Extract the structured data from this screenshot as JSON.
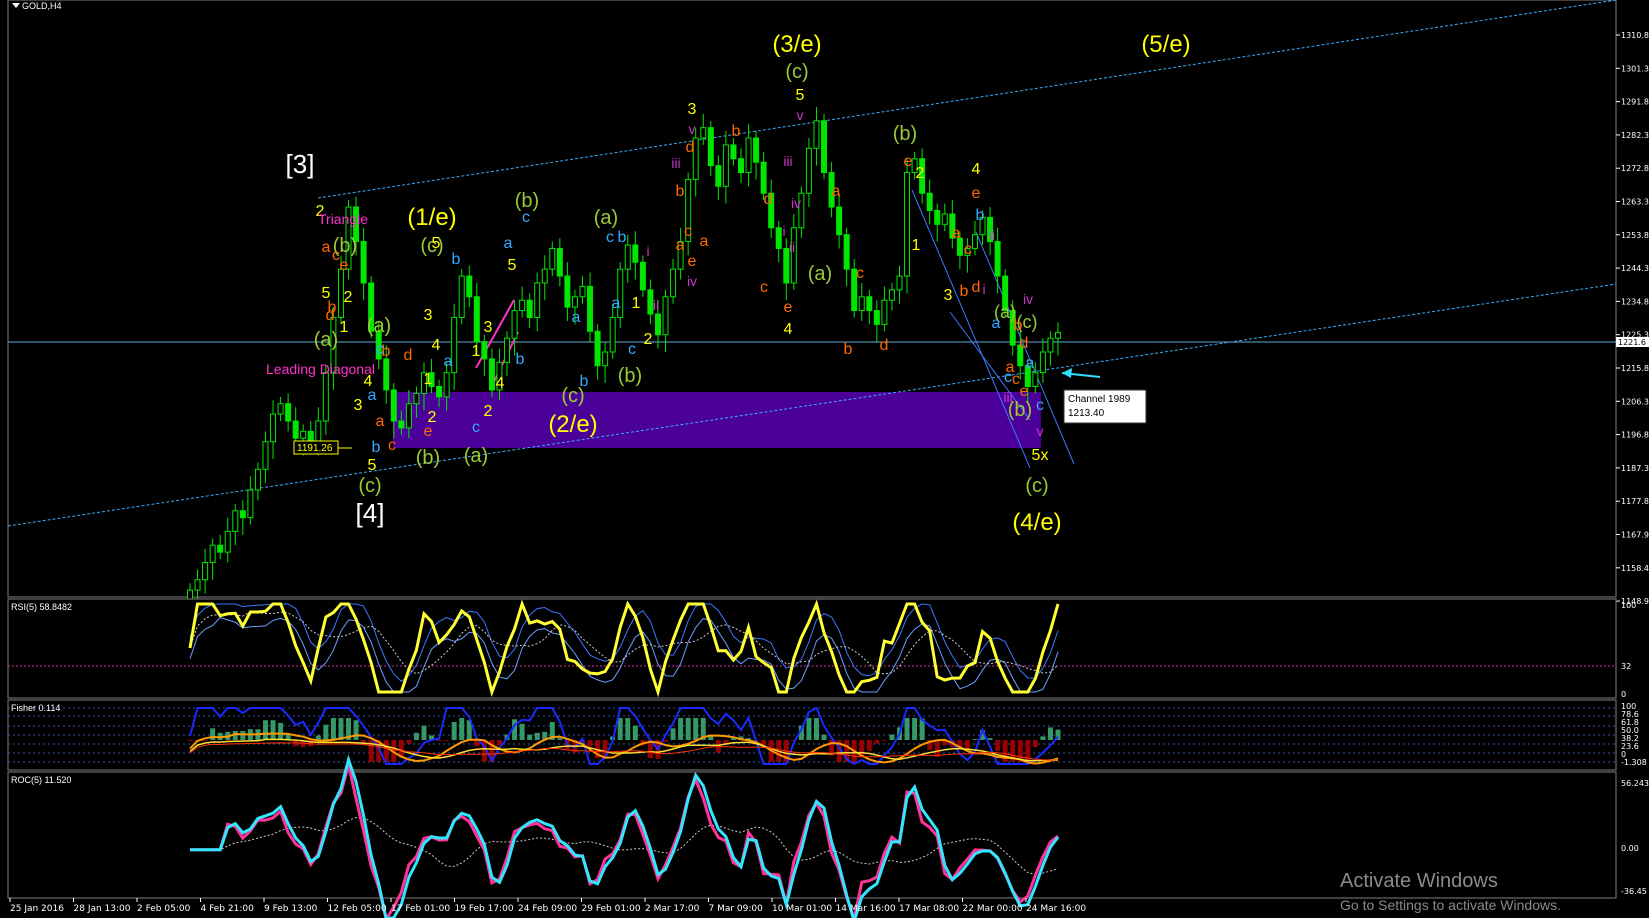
{
  "symbol": "GOLD,H4",
  "colors": {
    "background": "#000000",
    "candle": "#00e600",
    "channel": "#3fa9f5",
    "zone": "#4b0099",
    "rsi_main": "#ffff33",
    "rsi_band": "#3a78ff",
    "roc_cyan": "#33e6ff",
    "roc_pink": "#ff3399"
  },
  "price_axis": {
    "ticks": [
      "1310.8",
      "1301.3",
      "1291.8",
      "1282.3",
      "1272.8",
      "1263.3",
      "1253.8",
      "1244.3",
      "1234.8",
      "1225.3",
      "1215.8",
      "1206.3",
      "1196.8",
      "1187.3",
      "1177.8",
      "1167.9",
      "1158.4",
      "1148.9"
    ],
    "current_price": "1221.6"
  },
  "panels": {
    "rsi": {
      "label": "RSI(5) 58.8482",
      "ticks": [
        "100",
        "32",
        "0"
      ]
    },
    "stoch": {
      "label": "Fisher 0.114",
      "ticks": [
        "100",
        "78.6",
        "61.8",
        "50.0",
        "38.2",
        "23.6",
        "0",
        "-1.308"
      ]
    },
    "roc": {
      "label": "ROC(5) 11.520",
      "ticks": [
        "56.243",
        "0.00",
        "-36.45"
      ]
    }
  },
  "time_axis": [
    "25 Jan 2016",
    "28 Jan 13:00",
    "2 Feb 05:00",
    "4 Feb 21:00",
    "9 Feb 13:00",
    "12 Feb 05:00",
    "17 Feb 01:00",
    "19 Feb 17:00",
    "24 Feb 09:00",
    "29 Feb 01:00",
    "2 Mar 17:00",
    "7 Mar 09:00",
    "10 Mar 01:00",
    "14 Mar 16:00",
    "17 Mar 08:00",
    "22 Mar 00:00",
    "24 Mar 16:00"
  ],
  "annotations": {
    "channel_box_title": "Channel 1989",
    "channel_box_value": "1213.40",
    "level_label": "1191.26",
    "triangle": "Triangle",
    "leading_diagonal": "Leading Diagonal"
  },
  "waves": [
    {
      "t": "[3]",
      "c": "#ffffff",
      "s": 26,
      "x": 300,
      "y": 173
    },
    {
      "t": "[4]",
      "c": "#ffffff",
      "s": 26,
      "x": 370,
      "y": 522
    },
    {
      "t": "(1/e)",
      "c": "#ffff00",
      "s": 24,
      "x": 432,
      "y": 225
    },
    {
      "t": "(2/e)",
      "c": "#ffff00",
      "s": 24,
      "x": 573,
      "y": 432
    },
    {
      "t": "(3/e)",
      "c": "#ffff00",
      "s": 24,
      "x": 797,
      "y": 52
    },
    {
      "t": "(4/e)",
      "c": "#ffff00",
      "s": 24,
      "x": 1037,
      "y": 530
    },
    {
      "t": "(5/e)",
      "c": "#ffff00",
      "s": 24,
      "x": 1166,
      "y": 52
    },
    {
      "t": "(c)",
      "c": "#99cc33",
      "s": 20,
      "x": 797,
      "y": 78
    },
    {
      "t": "(c)",
      "c": "#99cc33",
      "s": 20,
      "x": 432,
      "y": 252
    },
    {
      "t": "(c)",
      "c": "#99cc33",
      "s": 20,
      "x": 370,
      "y": 492
    },
    {
      "t": "(c)",
      "c": "#99cc33",
      "s": 20,
      "x": 573,
      "y": 402
    },
    {
      "t": "(c)",
      "c": "#99cc33",
      "s": 20,
      "x": 1037,
      "y": 492
    },
    {
      "t": "(b)",
      "c": "#99cc33",
      "s": 20,
      "x": 527,
      "y": 207
    },
    {
      "t": "(b)",
      "c": "#99cc33",
      "s": 20,
      "x": 905,
      "y": 140
    },
    {
      "t": "(b)",
      "c": "#99cc33",
      "s": 20,
      "x": 345,
      "y": 252
    },
    {
      "t": "(b)",
      "c": "#99cc33",
      "s": 20,
      "x": 428,
      "y": 464
    },
    {
      "t": "(b)",
      "c": "#99cc33",
      "s": 20,
      "x": 630,
      "y": 382
    },
    {
      "t": "(b)",
      "c": "#99cc33",
      "s": 20,
      "x": 1020,
      "y": 416
    },
    {
      "t": "(a)",
      "c": "#99cc33",
      "s": 20,
      "x": 606,
      "y": 224
    },
    {
      "t": "(a)",
      "c": "#99cc33",
      "s": 20,
      "x": 379,
      "y": 332
    },
    {
      "t": "(a)",
      "c": "#99cc33",
      "s": 20,
      "x": 326,
      "y": 346
    },
    {
      "t": "(a)",
      "c": "#99cc33",
      "s": 20,
      "x": 476,
      "y": 462
    },
    {
      "t": "(a)",
      "c": "#99cc33",
      "s": 20,
      "x": 820,
      "y": 280
    },
    {
      "t": "(a)",
      "c": "#99cc33",
      "s": 18,
      "x": 1005,
      "y": 318
    },
    {
      "t": "(c)",
      "c": "#99cc33",
      "s": 18,
      "x": 1027,
      "y": 328
    },
    {
      "t": "5",
      "c": "#ffff00",
      "s": 16,
      "x": 800,
      "y": 100
    },
    {
      "t": "3",
      "c": "#ffff00",
      "s": 16,
      "x": 692,
      "y": 114
    },
    {
      "t": "5",
      "c": "#ffff00",
      "s": 16,
      "x": 436,
      "y": 248
    },
    {
      "t": "5",
      "c": "#ffff00",
      "s": 16,
      "x": 512,
      "y": 270
    },
    {
      "t": "3",
      "c": "#ffff00",
      "s": 16,
      "x": 488,
      "y": 332
    },
    {
      "t": "3",
      "c": "#ffff00",
      "s": 16,
      "x": 428,
      "y": 320
    },
    {
      "t": "4",
      "c": "#ffff00",
      "s": 16,
      "x": 436,
      "y": 350
    },
    {
      "t": "1",
      "c": "#ffff00",
      "s": 16,
      "x": 428,
      "y": 384
    },
    {
      "t": "2",
      "c": "#ffff00",
      "s": 16,
      "x": 432,
      "y": 422
    },
    {
      "t": "1",
      "c": "#ffff00",
      "s": 16,
      "x": 476,
      "y": 356
    },
    {
      "t": "2",
      "c": "#ffff00",
      "s": 16,
      "x": 488,
      "y": 416
    },
    {
      "t": "4",
      "c": "#ffff00",
      "s": 16,
      "x": 500,
      "y": 388
    },
    {
      "t": "1",
      "c": "#ffff00",
      "s": 16,
      "x": 636,
      "y": 308
    },
    {
      "t": "2",
      "c": "#ffff00",
      "s": 16,
      "x": 648,
      "y": 344
    },
    {
      "t": "4",
      "c": "#ffff00",
      "s": 16,
      "x": 788,
      "y": 334
    },
    {
      "t": "2",
      "c": "#ffff00",
      "s": 16,
      "x": 920,
      "y": 178
    },
    {
      "t": "4",
      "c": "#ffff00",
      "s": 16,
      "x": 976,
      "y": 174
    },
    {
      "t": "1",
      "c": "#ffff00",
      "s": 16,
      "x": 916,
      "y": 250
    },
    {
      "t": "3",
      "c": "#ffff00",
      "s": 16,
      "x": 948,
      "y": 300
    },
    {
      "t": "5x",
      "c": "#ffff00",
      "s": 16,
      "x": 1040,
      "y": 460
    },
    {
      "t": "2",
      "c": "#ffff00",
      "s": 16,
      "x": 320,
      "y": 216
    },
    {
      "t": "2",
      "c": "#ffff00",
      "s": 16,
      "x": 348,
      "y": 302
    },
    {
      "t": "1",
      "c": "#ffff00",
      "s": 16,
      "x": 344,
      "y": 332
    },
    {
      "t": "5",
      "c": "#ffff00",
      "s": 16,
      "x": 326,
      "y": 298
    },
    {
      "t": "4",
      "c": "#ffff00",
      "s": 16,
      "x": 368,
      "y": 386
    },
    {
      "t": "3",
      "c": "#ffff00",
      "s": 16,
      "x": 358,
      "y": 410
    },
    {
      "t": "5",
      "c": "#ffff00",
      "s": 16,
      "x": 372,
      "y": 470
    },
    {
      "t": "e",
      "c": "#ff6600",
      "s": 16,
      "x": 428,
      "y": 436
    },
    {
      "t": "c",
      "c": "#ff6600",
      "s": 16,
      "x": 392,
      "y": 450
    },
    {
      "t": "a",
      "c": "#ff6600",
      "s": 16,
      "x": 380,
      "y": 426
    },
    {
      "t": "d",
      "c": "#ff6600",
      "s": 16,
      "x": 408,
      "y": 360
    },
    {
      "t": "b",
      "c": "#ff6600",
      "s": 16,
      "x": 386,
      "y": 356
    },
    {
      "t": "d",
      "c": "#ff6600",
      "s": 16,
      "x": 690,
      "y": 152
    },
    {
      "t": "b",
      "c": "#ff6600",
      "s": 16,
      "x": 736,
      "y": 136
    },
    {
      "t": "b",
      "c": "#ff6600",
      "s": 16,
      "x": 680,
      "y": 196
    },
    {
      "t": "c",
      "c": "#ff6600",
      "s": 16,
      "x": 688,
      "y": 236
    },
    {
      "t": "e",
      "c": "#ff6600",
      "s": 16,
      "x": 692,
      "y": 266
    },
    {
      "t": "a",
      "c": "#ff6600",
      "s": 16,
      "x": 704,
      "y": 246
    },
    {
      "t": "a",
      "c": "#ff6600",
      "s": 16,
      "x": 680,
      "y": 250
    },
    {
      "t": "d",
      "c": "#ff6600",
      "s": 16,
      "x": 768,
      "y": 204
    },
    {
      "t": "c",
      "c": "#ff6600",
      "s": 16,
      "x": 764,
      "y": 292
    },
    {
      "t": "e",
      "c": "#ff6600",
      "s": 16,
      "x": 788,
      "y": 312
    },
    {
      "t": "a",
      "c": "#ff6600",
      "s": 16,
      "x": 836,
      "y": 196
    },
    {
      "t": "c",
      "c": "#ff6600",
      "s": 16,
      "x": 860,
      "y": 278
    },
    {
      "t": "b",
      "c": "#ff6600",
      "s": 16,
      "x": 848,
      "y": 354
    },
    {
      "t": "d",
      "c": "#ff6600",
      "s": 16,
      "x": 884,
      "y": 350
    },
    {
      "t": "e",
      "c": "#ff6600",
      "s": 16,
      "x": 908,
      "y": 166
    },
    {
      "t": "e",
      "c": "#ff6600",
      "s": 16,
      "x": 976,
      "y": 198
    },
    {
      "t": "a",
      "c": "#ff6600",
      "s": 16,
      "x": 956,
      "y": 238
    },
    {
      "t": "c",
      "c": "#ff6600",
      "s": 16,
      "x": 968,
      "y": 254
    },
    {
      "t": "b",
      "c": "#ff6600",
      "s": 16,
      "x": 964,
      "y": 296
    },
    {
      "t": "d",
      "c": "#ff6600",
      "s": 16,
      "x": 976,
      "y": 292
    },
    {
      "t": "a",
      "c": "#ff6600",
      "s": 16,
      "x": 1010,
      "y": 372
    },
    {
      "t": "c",
      "c": "#ff6600",
      "s": 16,
      "x": 1016,
      "y": 384
    },
    {
      "t": "e",
      "c": "#ff6600",
      "s": 16,
      "x": 1024,
      "y": 396
    },
    {
      "t": "d",
      "c": "#ff6600",
      "s": 16,
      "x": 1024,
      "y": 348
    },
    {
      "t": "b",
      "c": "#ff6600",
      "s": 16,
      "x": 1018,
      "y": 330
    },
    {
      "t": "e",
      "c": "#ff6600",
      "s": 16,
      "x": 344,
      "y": 270
    },
    {
      "t": "c",
      "c": "#ff6600",
      "s": 16,
      "x": 336,
      "y": 260
    },
    {
      "t": "a",
      "c": "#ff6600",
      "s": 16,
      "x": 326,
      "y": 252
    },
    {
      "t": "d",
      "c": "#ff6600",
      "s": 16,
      "x": 330,
      "y": 320
    },
    {
      "t": "b",
      "c": "#ff6600",
      "s": 16,
      "x": 332,
      "y": 312
    },
    {
      "t": "c",
      "c": "#33aaff",
      "s": 16,
      "x": 526,
      "y": 222
    },
    {
      "t": "b",
      "c": "#33aaff",
      "s": 16,
      "x": 456,
      "y": 264
    },
    {
      "t": "a",
      "c": "#33aaff",
      "s": 16,
      "x": 508,
      "y": 248
    },
    {
      "t": "a",
      "c": "#33aaff",
      "s": 16,
      "x": 448,
      "y": 366
    },
    {
      "t": "a",
      "c": "#33aaff",
      "s": 16,
      "x": 372,
      "y": 400
    },
    {
      "t": "b",
      "c": "#33aaff",
      "s": 16,
      "x": 520,
      "y": 364
    },
    {
      "t": "c",
      "c": "#33aaff",
      "s": 16,
      "x": 476,
      "y": 432
    },
    {
      "t": "c",
      "c": "#33aaff",
      "s": 16,
      "x": 380,
      "y": 354
    },
    {
      "t": "b",
      "c": "#33aaff",
      "s": 16,
      "x": 376,
      "y": 452
    },
    {
      "t": "a",
      "c": "#33aaff",
      "s": 16,
      "x": 576,
      "y": 322
    },
    {
      "t": "b",
      "c": "#33aaff",
      "s": 16,
      "x": 584,
      "y": 386
    },
    {
      "t": "c",
      "c": "#33aaff",
      "s": 16,
      "x": 610,
      "y": 242
    },
    {
      "t": "b",
      "c": "#33aaff",
      "s": 16,
      "x": 622,
      "y": 242
    },
    {
      "t": "c",
      "c": "#33aaff",
      "s": 16,
      "x": 632,
      "y": 354
    },
    {
      "t": "a",
      "c": "#33aaff",
      "s": 16,
      "x": 616,
      "y": 308
    },
    {
      "t": "b",
      "c": "#33aaff",
      "s": 16,
      "x": 980,
      "y": 220
    },
    {
      "t": "a",
      "c": "#33aaff",
      "s": 16,
      "x": 996,
      "y": 328
    },
    {
      "t": "c",
      "c": "#33aaff",
      "s": 16,
      "x": 1040,
      "y": 410
    },
    {
      "t": "a",
      "c": "#33aaff",
      "s": 16,
      "x": 1030,
      "y": 368
    },
    {
      "t": "c",
      "c": "#33aaff",
      "s": 16,
      "x": 1008,
      "y": 382
    },
    {
      "t": "iii",
      "c": "#cc33cc",
      "s": 14,
      "x": 676,
      "y": 168
    },
    {
      "t": "v",
      "c": "#cc33cc",
      "s": 14,
      "x": 692,
      "y": 134
    },
    {
      "t": "iv",
      "c": "#cc33cc",
      "s": 14,
      "x": 692,
      "y": 286
    },
    {
      "t": "v",
      "c": "#cc33cc",
      "s": 14,
      "x": 800,
      "y": 120
    },
    {
      "t": "iii",
      "c": "#cc33cc",
      "s": 14,
      "x": 788,
      "y": 166
    },
    {
      "t": "iv",
      "c": "#cc33cc",
      "s": 14,
      "x": 796,
      "y": 208
    },
    {
      "t": "i",
      "c": "#cc33cc",
      "s": 14,
      "x": 784,
      "y": 236
    },
    {
      "t": "ii",
      "c": "#cc33cc",
      "s": 14,
      "x": 792,
      "y": 252
    },
    {
      "t": "i",
      "c": "#cc33cc",
      "s": 14,
      "x": 648,
      "y": 256
    },
    {
      "t": "ii",
      "c": "#cc33cc",
      "s": 14,
      "x": 656,
      "y": 310
    },
    {
      "t": "ii",
      "c": "#cc33cc",
      "s": 14,
      "x": 992,
      "y": 240
    },
    {
      "t": "i",
      "c": "#cc33cc",
      "s": 14,
      "x": 984,
      "y": 294
    },
    {
      "t": "iv",
      "c": "#cc33cc",
      "s": 14,
      "x": 1028,
      "y": 304
    },
    {
      "t": "iii",
      "c": "#cc33cc",
      "s": 14,
      "x": 1008,
      "y": 402
    },
    {
      "t": "v",
      "c": "#cc33cc",
      "s": 14,
      "x": 1040,
      "y": 436
    }
  ],
  "chart_data": {
    "type": "candlestick",
    "instrument": "GOLD",
    "timeframe": "H4",
    "period": "25 Jan 2016 – 24 Mar 2016",
    "last_price": 1221.6,
    "price_range": [
      1145,
      1318
    ],
    "channel_level": 1213.4,
    "marked_level": 1191.26,
    "support_zone": [
      1191,
      1207
    ],
    "close_series": [
      1147,
      1150,
      1155,
      1160,
      1158,
      1164,
      1170,
      1168,
      1176,
      1182,
      1190,
      1198,
      1201,
      1196,
      1191,
      1193,
      1189,
      1196,
      1210,
      1226,
      1240,
      1258,
      1248,
      1236,
      1222,
      1214,
      1205,
      1196,
      1194,
      1201,
      1204,
      1210,
      1206,
      1203,
      1210,
      1226,
      1238,
      1232,
      1219,
      1214,
      1205,
      1213,
      1220,
      1228,
      1231,
      1226,
      1236,
      1240,
      1246,
      1238,
      1229,
      1232,
      1235,
      1222,
      1212,
      1216,
      1226,
      1240,
      1247,
      1242,
      1234,
      1227,
      1221,
      1232,
      1240,
      1248,
      1266,
      1278,
      1281,
      1270,
      1264,
      1276,
      1272,
      1268,
      1278,
      1271,
      1262,
      1252,
      1246,
      1236,
      1252,
      1262,
      1275,
      1283,
      1268,
      1258,
      1250,
      1240,
      1228,
      1232,
      1228,
      1224,
      1231,
      1234,
      1238,
      1268,
      1272,
      1262,
      1257,
      1253,
      1256,
      1249,
      1244,
      1246,
      1250,
      1255,
      1248,
      1238,
      1228,
      1218,
      1212,
      1206,
      1210,
      1216,
      1220,
      1221.6
    ],
    "rsi": {
      "name": "RSI(5)",
      "last": 58.8482,
      "levels": [
        100,
        32,
        0
      ]
    },
    "fisher": {
      "name": "Fisher",
      "last": 0.114
    },
    "roc": {
      "name": "ROC(5)",
      "last": 11.52,
      "ylim": [
        -36.45,
        56.243
      ]
    }
  }
}
